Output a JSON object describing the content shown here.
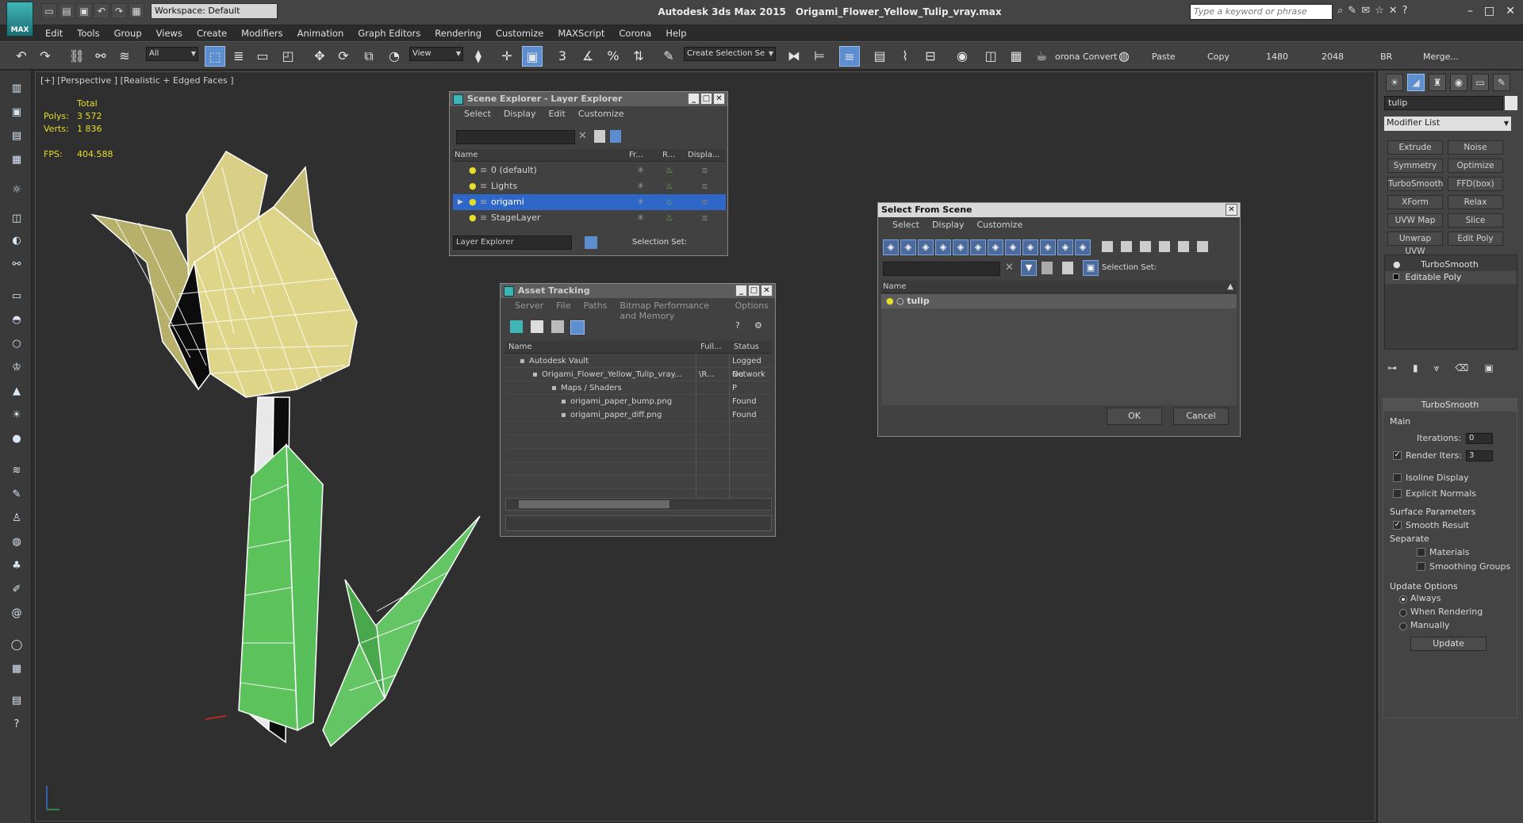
{
  "app": {
    "logo_text": "MAX",
    "title": "Autodesk 3ds Max  2015",
    "filename": "Origami_Flower_Yellow_Tulip_vray.max",
    "workspace": "Workspace: Default",
    "search_placeholder": "Type a keyword or phrase"
  },
  "menu": [
    "Edit",
    "Tools",
    "Group",
    "Views",
    "Create",
    "Modifiers",
    "Animation",
    "Graph Editors",
    "Rendering",
    "Customize",
    "MAXScript",
    "Corona",
    "Help"
  ],
  "toolbar": {
    "filter": "All",
    "view": "View",
    "selection_set": "Create Selection Se",
    "corona_convert": "orona Convert",
    "paste": "Paste",
    "copy": "Copy",
    "val1": "1480",
    "val2": "2048",
    "br": "BR",
    "merge": "Merge..."
  },
  "viewport": {
    "label": "[+] [Perspective ] [Realistic + Edged Faces ]",
    "stats_total": "Total",
    "polys_label": "Polys:",
    "polys_value": "3 572",
    "verts_label": "Verts:",
    "verts_value": "1 836",
    "fps_label": "FPS:",
    "fps_value": "404.588"
  },
  "scene_explorer": {
    "title": "Scene Explorer - Layer Explorer",
    "menu": [
      "Select",
      "Display",
      "Edit",
      "Customize"
    ],
    "headers": [
      "Name",
      "Fr...",
      "R...",
      "Displa..."
    ],
    "rows": [
      "0 (default)",
      "Lights",
      "origami",
      "StageLayer"
    ],
    "footer_mode": "Layer Explorer",
    "footer_sel": "Selection Set:"
  },
  "asset_tracking": {
    "title": "Asset Tracking",
    "menu": [
      "Server",
      "File",
      "Paths",
      "Bitmap Performance and Memory",
      "Options"
    ],
    "headers": [
      "Name",
      "Full...",
      "Status"
    ],
    "rows": [
      {
        "name": "Autodesk Vault",
        "full": "",
        "status": "Logged Ou"
      },
      {
        "name": "Origami_Flower_Yellow_Tulip_vray...",
        "full": "\\R...",
        "status": "Network P"
      },
      {
        "name": "Maps / Shaders",
        "full": "",
        "status": ""
      },
      {
        "name": "origami_paper_bump.png",
        "full": "",
        "status": "Found"
      },
      {
        "name": "origami_paper_diff.png",
        "full": "",
        "status": "Found"
      }
    ]
  },
  "select_from_scene": {
    "title": "Select From Scene",
    "menu": [
      "Select",
      "Display",
      "Customize"
    ],
    "sel_set": "Selection Set:",
    "header": "Name",
    "rows": [
      "tulip"
    ],
    "ok": "OK",
    "cancel": "Cancel"
  },
  "command_panel": {
    "object_name": "tulip",
    "modifier_list": "Modifier List",
    "buttons": [
      "Extrude",
      "Noise",
      "Symmetry",
      "Optimize",
      "TurboSmooth",
      "FFD(box)",
      "XForm",
      "Relax",
      "UVW Map",
      "Slice",
      "Unwrap UVW",
      "Edit Poly"
    ],
    "stack": [
      "TurboSmooth",
      "Editable Poly"
    ],
    "rollout_title": "TurboSmooth",
    "main_label": "Main",
    "iterations_label": "Iterations:",
    "iterations_value": "0",
    "render_iters_label": "Render Iters:",
    "render_iters_value": "3",
    "isoline": "Isoline Display",
    "explicit_normals": "Explicit Normals",
    "surface_params": "Surface Parameters",
    "smooth_result": "Smooth Result",
    "separate": "Separate",
    "materials": "Materials",
    "smoothing_groups": "Smoothing Groups",
    "update_options": "Update Options",
    "always": "Always",
    "when_rendering": "When Rendering",
    "manually": "Manually",
    "update": "Update"
  },
  "colors": {
    "petal": "#d8cf86",
    "leaf": "#58c05a",
    "selection": "#2f67c9",
    "stats": "#e6df2a"
  }
}
